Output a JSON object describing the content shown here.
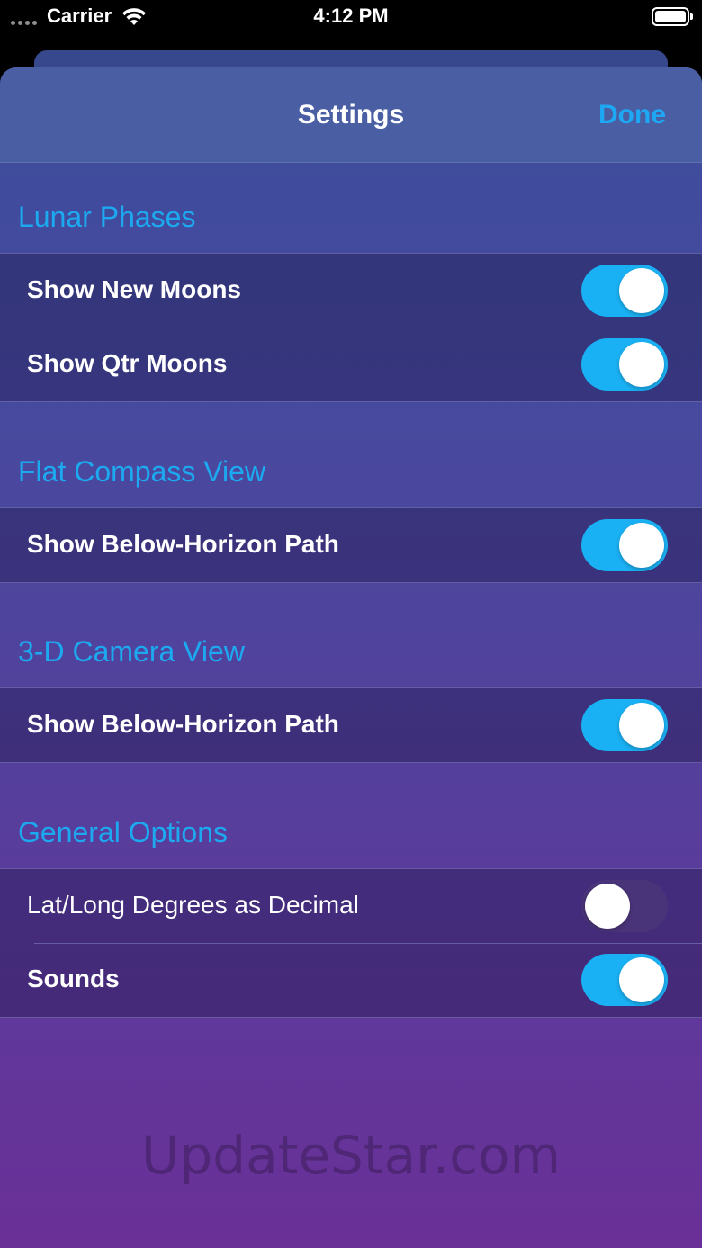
{
  "status_bar": {
    "carrier": "Carrier",
    "time": "4:12 PM"
  },
  "nav": {
    "title": "Settings",
    "done_label": "Done"
  },
  "sections": [
    {
      "header": "Lunar Phases",
      "rows": [
        {
          "label": "Show New Moons",
          "on": true
        },
        {
          "label": "Show Qtr Moons",
          "on": true
        }
      ]
    },
    {
      "header": "Flat Compass View",
      "rows": [
        {
          "label": "Show Below-Horizon Path",
          "on": true
        }
      ]
    },
    {
      "header": "3-D Camera View",
      "rows": [
        {
          "label": "Show Below-Horizon Path",
          "on": true
        }
      ]
    },
    {
      "header": "General Options",
      "rows": [
        {
          "label": "Lat/Long Degrees as Decimal",
          "on": false
        },
        {
          "label": "Sounds",
          "on": true
        }
      ]
    }
  ],
  "watermark": "UpdateStar.com",
  "colors": {
    "accent": "#1da9ef",
    "toggle_on": "#1ab1f4"
  },
  "icons": [
    "signal-dots-icon",
    "wifi-icon",
    "battery-icon"
  ]
}
